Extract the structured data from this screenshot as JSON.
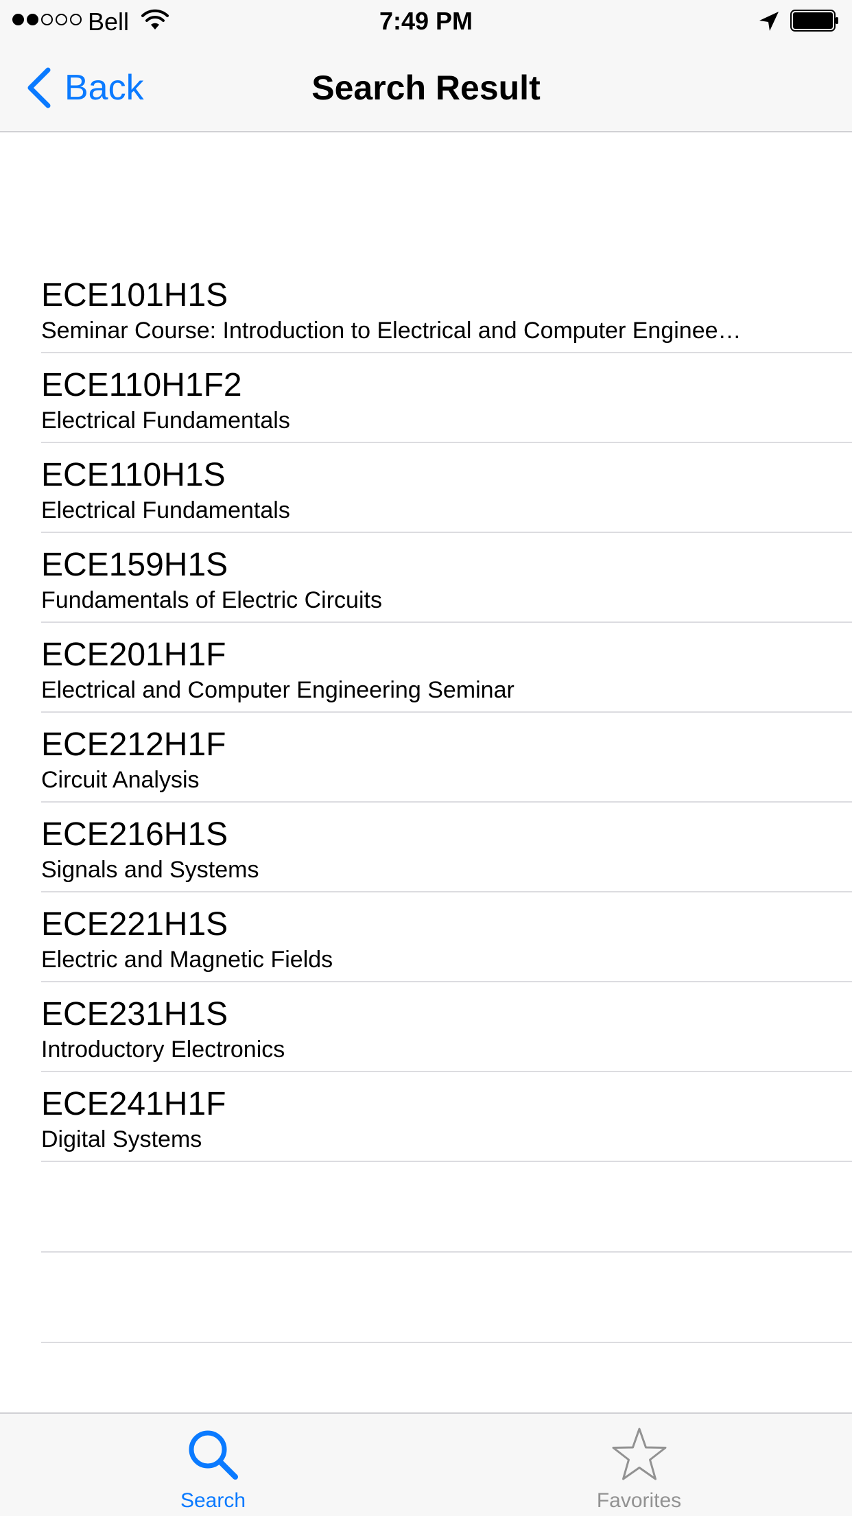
{
  "status_bar": {
    "carrier": "Bell",
    "time": "7:49 PM",
    "signal_strength": 2,
    "signal_total": 5
  },
  "nav": {
    "back_label": "Back",
    "title": "Search Result"
  },
  "courses": [
    {
      "code": "ECE101H1S",
      "title": "Seminar Course: Introduction to Electrical and Computer Enginee…"
    },
    {
      "code": "ECE110H1F2",
      "title": "Electrical Fundamentals"
    },
    {
      "code": "ECE110H1S",
      "title": "Electrical Fundamentals"
    },
    {
      "code": "ECE159H1S",
      "title": "Fundamentals of Electric Circuits"
    },
    {
      "code": "ECE201H1F",
      "title": "Electrical and Computer Engineering Seminar"
    },
    {
      "code": "ECE212H1F",
      "title": "Circuit Analysis"
    },
    {
      "code": "ECE216H1S",
      "title": "Signals and Systems"
    },
    {
      "code": "ECE221H1S",
      "title": "Electric and Magnetic Fields"
    },
    {
      "code": "ECE231H1S",
      "title": "Introductory Electronics"
    },
    {
      "code": "ECE241H1F",
      "title": "Digital Systems"
    }
  ],
  "tab_bar": {
    "tabs": [
      {
        "label": "Search",
        "icon": "search-icon",
        "selected": true
      },
      {
        "label": "Favorites",
        "icon": "star-icon",
        "selected": false
      }
    ]
  },
  "colors": {
    "accent": "#0a7aff",
    "inactive_tab": "#929292",
    "separator": "#dcdce0",
    "bar_background": "#f7f7f7"
  }
}
